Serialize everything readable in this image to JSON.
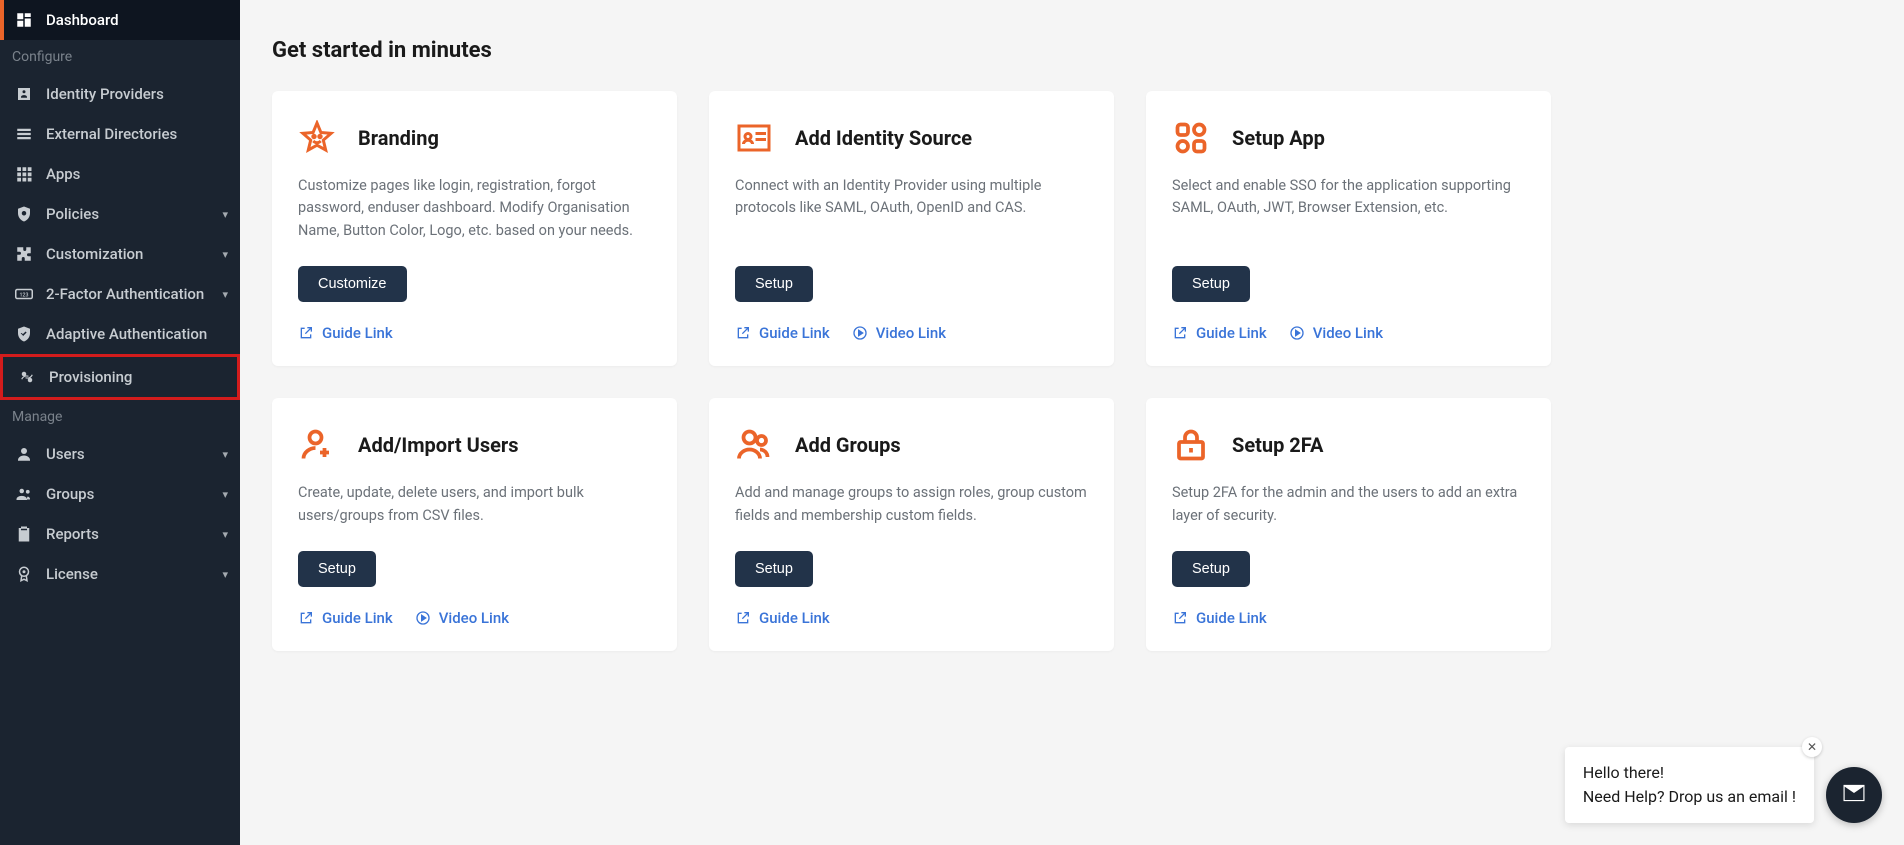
{
  "sidebar": {
    "sections": [
      {
        "items": [
          {
            "key": "dashboard",
            "label": "Dashboard",
            "active": true
          }
        ]
      },
      {
        "title": "Configure",
        "items": [
          {
            "key": "identity-providers",
            "label": "Identity Providers"
          },
          {
            "key": "external-directories",
            "label": "External Directories"
          },
          {
            "key": "apps",
            "label": "Apps"
          },
          {
            "key": "policies",
            "label": "Policies",
            "expandable": true
          },
          {
            "key": "customization",
            "label": "Customization",
            "expandable": true
          },
          {
            "key": "2fa",
            "label": "2-Factor Authentication",
            "expandable": true
          },
          {
            "key": "adaptive-auth",
            "label": "Adaptive Authentication"
          },
          {
            "key": "provisioning",
            "label": "Provisioning",
            "highlighted": true
          }
        ]
      },
      {
        "title": "Manage",
        "items": [
          {
            "key": "users",
            "label": "Users",
            "expandable": true
          },
          {
            "key": "groups",
            "label": "Groups",
            "expandable": true
          },
          {
            "key": "reports",
            "label": "Reports",
            "expandable": true
          },
          {
            "key": "license",
            "label": "License",
            "expandable": true
          }
        ]
      }
    ]
  },
  "main": {
    "title": "Get started in minutes",
    "cards": [
      {
        "icon": "star",
        "title": "Branding",
        "desc": "Customize pages like login, registration, forgot password, enduser dashboard. Modify Organisation Name, Button Color, Logo, etc. based on your needs.",
        "button": "Customize",
        "links": [
          {
            "type": "guide",
            "label": "Guide Link"
          }
        ]
      },
      {
        "icon": "id-card",
        "title": "Add Identity Source",
        "desc": "Connect with an Identity Provider using multiple protocols like SAML, OAuth, OpenID and CAS.",
        "button": "Setup",
        "links": [
          {
            "type": "guide",
            "label": "Guide Link"
          },
          {
            "type": "video",
            "label": "Video Link"
          }
        ]
      },
      {
        "icon": "apps",
        "title": "Setup App",
        "desc": "Select and enable SSO for the application supporting SAML, OAuth, JWT, Browser Extension, etc.",
        "button": "Setup",
        "links": [
          {
            "type": "guide",
            "label": "Guide Link"
          },
          {
            "type": "video",
            "label": "Video Link"
          }
        ]
      },
      {
        "icon": "user-plus",
        "title": "Add/Import Users",
        "desc": "Create, update, delete users, and import bulk users/groups from CSV files.",
        "button": "Setup",
        "links": [
          {
            "type": "guide",
            "label": "Guide Link"
          },
          {
            "type": "video",
            "label": "Video Link"
          }
        ]
      },
      {
        "icon": "users",
        "title": "Add Groups",
        "desc": "Add and manage groups to assign roles, group custom fields and membership custom fields.",
        "button": "Setup",
        "links": [
          {
            "type": "guide",
            "label": "Guide Link"
          }
        ]
      },
      {
        "icon": "lock",
        "title": "Setup 2FA",
        "desc": "Setup 2FA for the admin and the users to add an extra layer of security.",
        "button": "Setup",
        "links": [
          {
            "type": "guide",
            "label": "Guide Link"
          }
        ]
      }
    ]
  },
  "chat": {
    "line1": "Hello there!",
    "line2": "Need Help? Drop us an email !"
  },
  "colors": {
    "accent": "#eb6429",
    "link": "#3a74d8",
    "button": "#223349"
  }
}
